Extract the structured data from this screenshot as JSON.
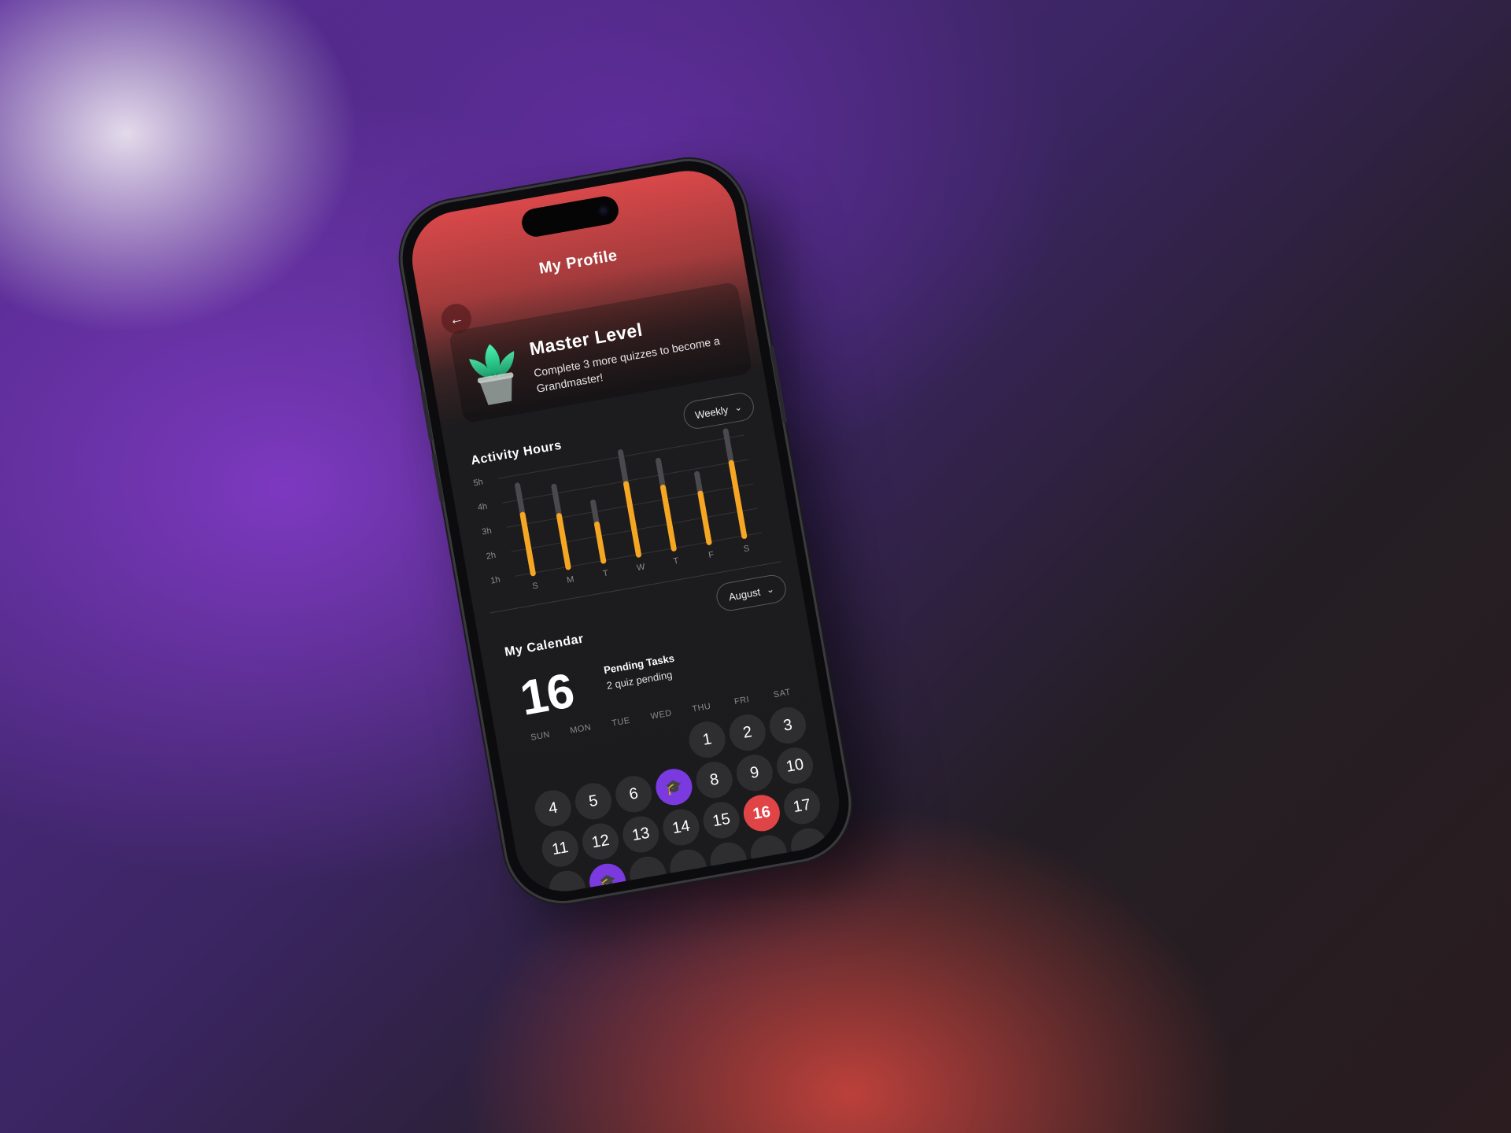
{
  "header": {
    "title": "My Profile"
  },
  "level": {
    "title": "Master Level",
    "description": "Complete 3 more quizzes to become a Grandmaster!"
  },
  "activity": {
    "title": "Activity Hours",
    "period": "Weekly"
  },
  "chart_data": {
    "type": "bar",
    "title": "Activity Hours",
    "categories": [
      "S",
      "M",
      "T",
      "W",
      "T",
      "F",
      "S"
    ],
    "yticks": [
      "1h",
      "2h",
      "3h",
      "4h",
      "5h"
    ],
    "ylim": [
      1,
      5
    ],
    "series": [
      {
        "values": [
          3.5,
          3.2,
          2.6,
          4.0,
          3.6,
          3.1,
          4.1
        ],
        "color": "#f5a623"
      },
      {
        "values": [
          4.7,
          4.4,
          3.5,
          5.3,
          4.7,
          3.9,
          5.4
        ],
        "color": "#4a4a4e"
      }
    ],
    "grid": true
  },
  "calendar": {
    "title": "My Calendar",
    "month": "August",
    "selected_day": "16",
    "pending_title": "Pending Tasks",
    "pending_sub": "2 quiz pending",
    "weekdays": [
      "SUN",
      "MON",
      "TUE",
      "WED",
      "THU",
      "FRI",
      "SAT"
    ],
    "days": [
      "1",
      "2",
      "3",
      "4",
      "5",
      "6",
      "8",
      "9",
      "10",
      "11",
      "12",
      "13",
      "14",
      "15",
      "16",
      "17"
    ],
    "today": "16"
  },
  "icons": {
    "back": "arrow-left-icon",
    "chevron": "chevron-down-icon",
    "event": "graduation-cap-icon",
    "plant": "plant-icon"
  }
}
